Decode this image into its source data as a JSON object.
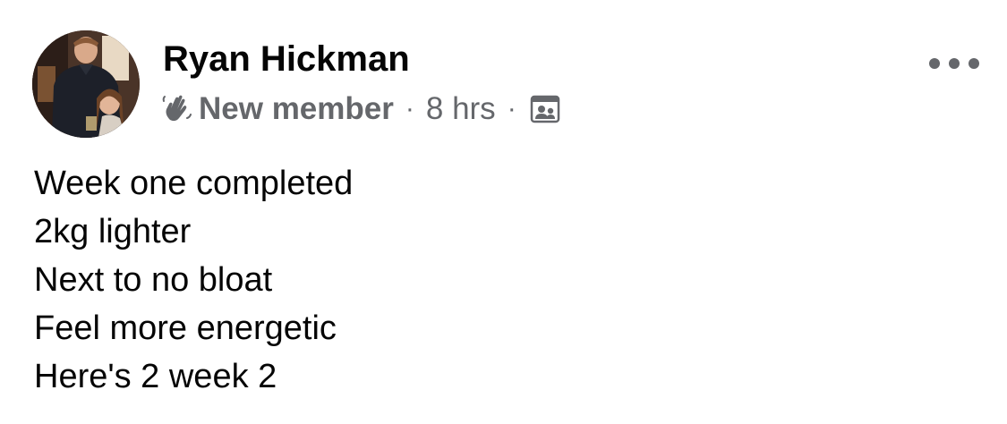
{
  "post": {
    "author": {
      "name": "Ryan Hickman",
      "avatar": "profile-photo"
    },
    "meta": {
      "badge_icon": "wave-icon",
      "badge": "New member",
      "separator": "·",
      "time": "8 hrs",
      "audience_icon": "group-audience-icon"
    },
    "more_icon": "more-options-icon",
    "body_lines": [
      "Week one completed",
      "2kg lighter",
      "Next to no bloat",
      "Feel more energetic",
      "Here's 2 week 2"
    ]
  },
  "colors": {
    "text_primary": "#050505",
    "text_secondary": "#65676b",
    "background": "#ffffff"
  }
}
